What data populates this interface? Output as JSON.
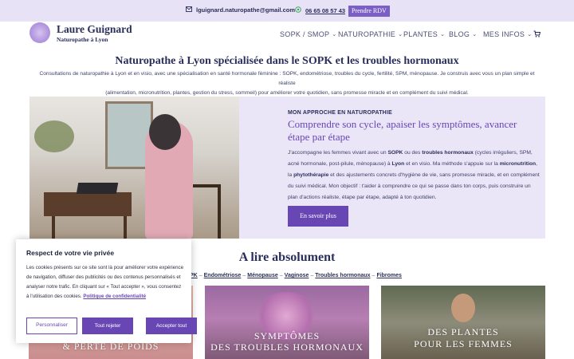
{
  "topbar": {
    "email": "lguignard.naturopathe@gmail.com",
    "phone": "06 65 08 57 43",
    "cta": "Prendre RDV"
  },
  "brand": {
    "name": "Laure Guignard",
    "subtitle": "Naturopathe à Lyon"
  },
  "nav": {
    "items": [
      {
        "label": "SOPK / SMOP"
      },
      {
        "label": "NATUROPATHIE"
      },
      {
        "label": "PLANTES"
      },
      {
        "label": "BLOG"
      },
      {
        "label": "MES INFOS"
      }
    ]
  },
  "hero": {
    "title": "Naturopathe à Lyon spécialisée dans le SOPK et les troubles hormonaux",
    "intro_line1": "Consultations de naturopathie à Lyon et en visio, avec une spécialisation en santé hormonale féminine : SOPK, endométriose, troubles du cycle, fertilité, SPM, ménopause. Je construis avec vous un plan simple et réaliste",
    "intro_line2": "(alimentation, micronutrition, plantes, gestion du stress, sommeil) pour améliorer votre quotidien, sans promesse miracle et en complément du suivi médical."
  },
  "approach": {
    "kicker": "MON APPROCHE EN NATUROPATHIE",
    "title": "Comprendre son cycle, apaiser les symptômes, avancer étape par étape",
    "p1": "J'accompagne les femmes vivant avec un ",
    "b1": "SOPK",
    "p2": " ou des ",
    "b2": "troubles hormonaux",
    "p3": " (cycles irréguliers, SPM, acné hormonale, post-pilule, ménopause) à ",
    "b3": "Lyon",
    "p4": " et en visio. Ma méthode s'appuie sur la ",
    "b4": "micronutrition",
    "p5": ", la ",
    "b5": "phytothérapie",
    "p6": " et des ajustements concrets d'hygiène de vie, sans promesse miracle, et en complément du suivi médical. Mon objectif : t'aider à comprendre ce qui se passe dans ton corps, puis construire un plan d'actions réaliste, étape par étape, adapté à ton quotidien.",
    "button": "En savoir plus"
  },
  "reading": {
    "title": "A lire absolument",
    "tags": [
      {
        "label": "PK"
      },
      {
        "label": "Endométriose"
      },
      {
        "label": "Ménopause"
      },
      {
        "label": "Vaginose"
      },
      {
        "label": "Troubles hormonaux"
      },
      {
        "label": "Fibromes"
      }
    ],
    "separator": "–",
    "cards": [
      {
        "caption": "& PERTE DE POIDS"
      },
      {
        "caption_l1": "SYMPTÔMES",
        "caption_l2": "DES TROUBLES HORMONAUX"
      },
      {
        "caption_l1": "DES PLANTES",
        "caption_l2": "POUR LES FEMMES"
      }
    ]
  },
  "cookie": {
    "title": "Respect de votre vie privée",
    "body": "Les cookies présents sur ce site sont là pour améliorer votre expérience de navigation, diffuser des publicités ou des contenus personnalisés et analyser notre trafic. En cliquant sur « Tout accepter », vous consentez à l'utilisation des cookies. ",
    "policy_link": "Politique de confidentialité",
    "btn_customize": "Personnaliser",
    "btn_reject": "Tout rejeter",
    "btn_accept": "Accepter tout"
  }
}
